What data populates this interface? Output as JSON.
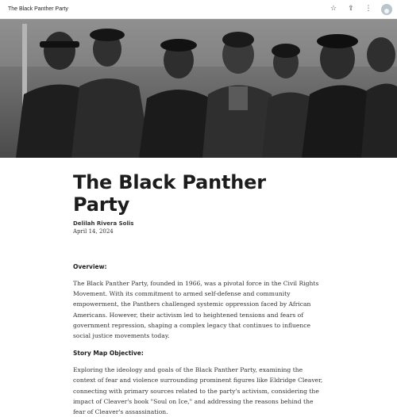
{
  "header": {
    "title": "The Black Panther Party",
    "icons": [
      "star-icon",
      "share-icon",
      "more-icon",
      "account-icon"
    ],
    "star_glyph": "☆",
    "share_glyph": "⇪",
    "more_glyph": "⋮"
  },
  "hero": {
    "image_alt": "Black and white photograph of Black Panther Party members in leather jackets and berets"
  },
  "article": {
    "title": "The Black Panther Party",
    "author": "Delilah Rivera Solis",
    "date": "April 14, 2024",
    "sections": [
      {
        "heading": "Overview:",
        "paragraph": "The Black Panther Party, founded in 1966, was a pivotal force in the Civil Rights Movement. With its commitment to armed self-defense and community empowerment, the Panthers challenged systemic oppression faced by African Americans. However, their activism led to heightened tensions and fears of government repression, shaping a complex legacy that continues to influence social justice movements today."
      },
      {
        "heading": "Story Map Objective:",
        "paragraph": "Exploring the ideology and goals of the Black Panther Party, examining the context of fear and violence surrounding prominent figures like Eldridge Cleaver, connecting with primary sources related to the party's activism, considering the impact of Cleaver's book \"Soul on Ice,\" and addressing the reasons behind the fear of Cleaver's assassination."
      }
    ]
  }
}
